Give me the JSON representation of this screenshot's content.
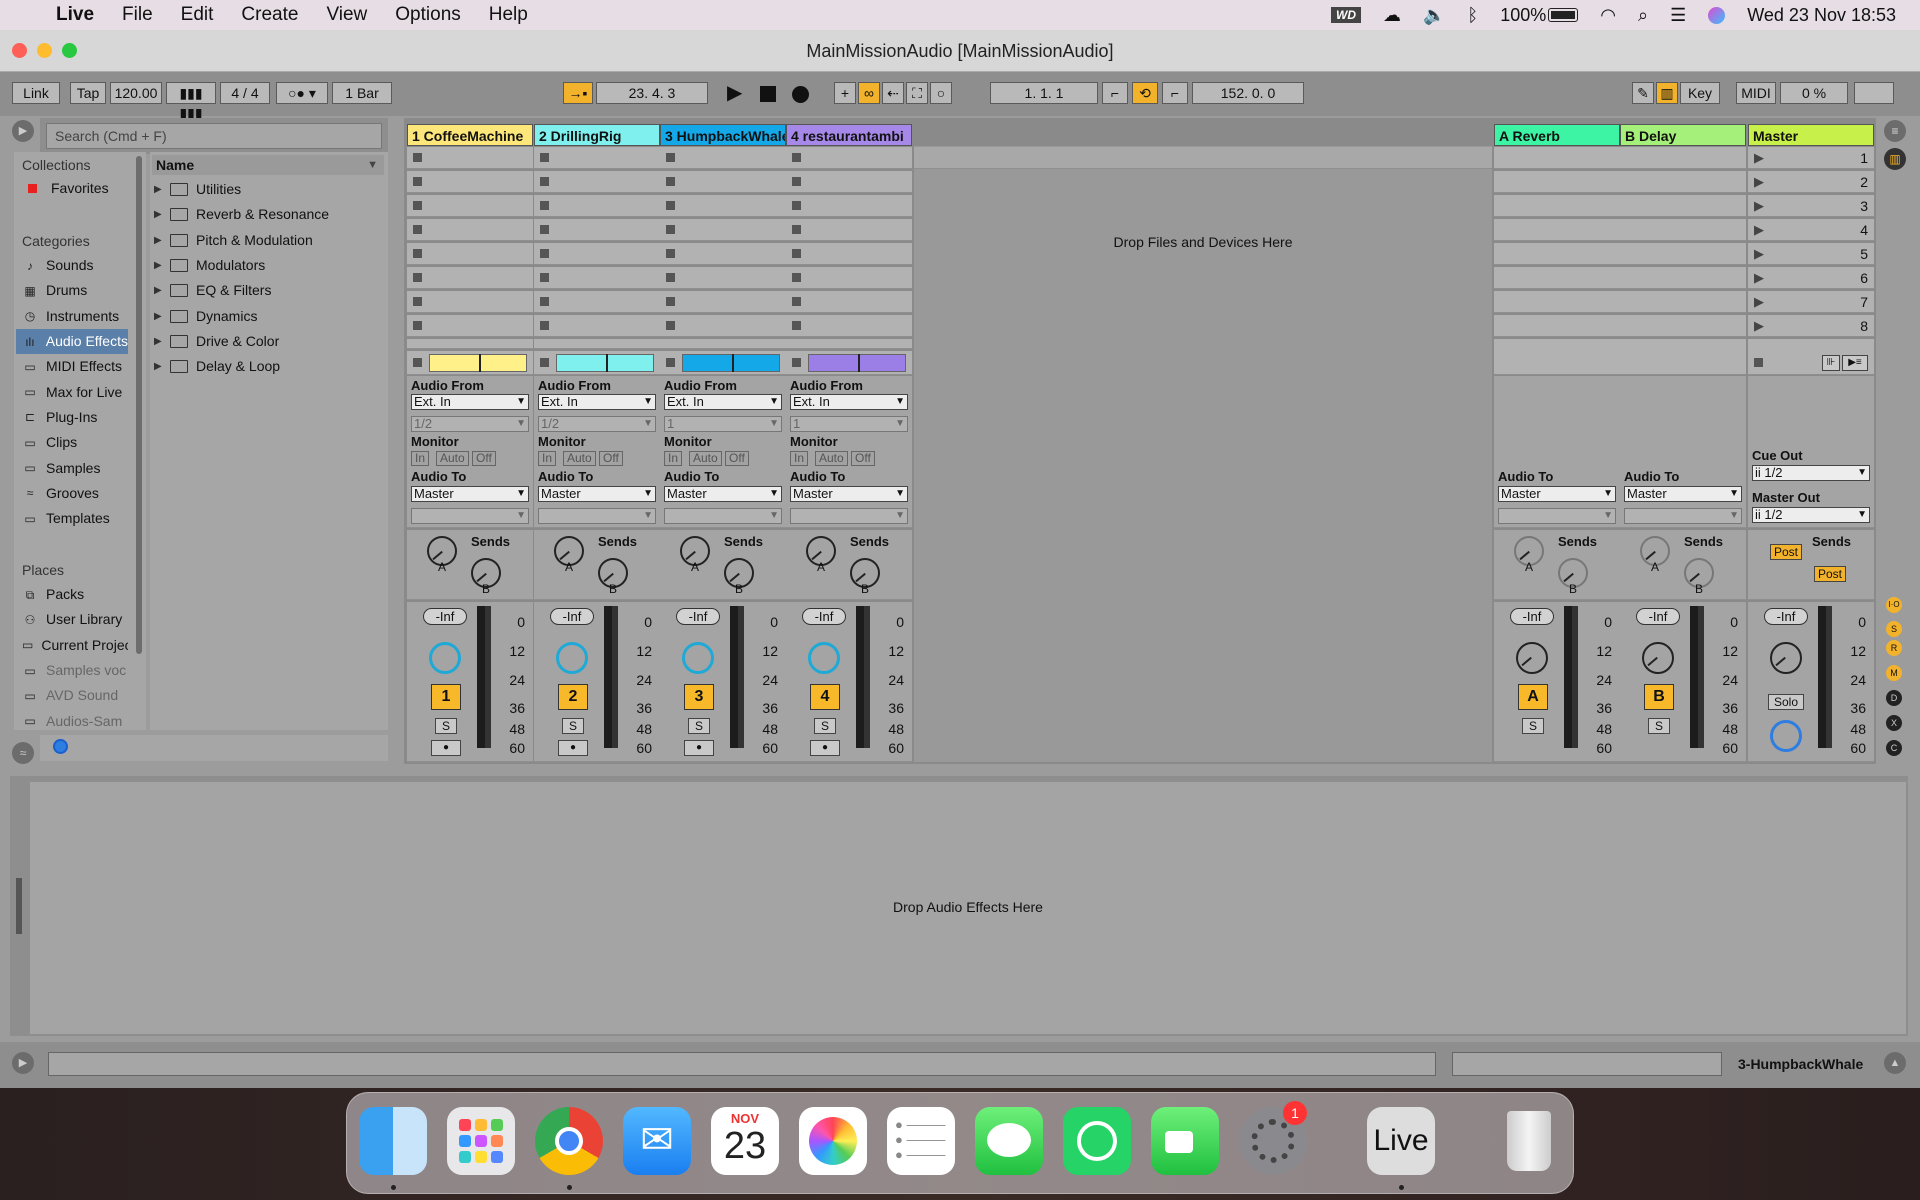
{
  "menubar": {
    "app": "Live",
    "items": [
      "File",
      "Edit",
      "Create",
      "View",
      "Options",
      "Help"
    ],
    "battery": "100%",
    "datetime": "Wed 23 Nov  18:53"
  },
  "window": {
    "title": "MainMissionAudio  [MainMissionAudio]"
  },
  "toolbar": {
    "link": "Link",
    "tap": "Tap",
    "tempo": "120.00",
    "signature": "4 / 4",
    "quant": "1 Bar",
    "position": "23.   4.   3",
    "loop_start": "1.   1.   1",
    "loop_length": "152.   0.   0",
    "key": "Key",
    "midi": "MIDI",
    "cpu": "0 %"
  },
  "browser": {
    "search_placeholder": "Search (Cmd + F)",
    "collections_label": "Collections",
    "favorites": "Favorites",
    "categories_label": "Categories",
    "categories": [
      {
        "label": "Sounds",
        "icon": "sounds-icon"
      },
      {
        "label": "Drums",
        "icon": "drums-icon"
      },
      {
        "label": "Instruments",
        "icon": "instruments-icon"
      },
      {
        "label": "Audio Effects",
        "icon": "audio-effects-icon"
      },
      {
        "label": "MIDI Effects",
        "icon": "midi-effects-icon"
      },
      {
        "label": "Max for Live",
        "icon": "max-icon"
      },
      {
        "label": "Plug-Ins",
        "icon": "plugins-icon"
      },
      {
        "label": "Clips",
        "icon": "clips-icon"
      },
      {
        "label": "Samples",
        "icon": "samples-icon"
      },
      {
        "label": "Grooves",
        "icon": "grooves-icon"
      },
      {
        "label": "Templates",
        "icon": "templates-icon"
      }
    ],
    "places_label": "Places",
    "places": [
      {
        "label": "Packs"
      },
      {
        "label": "User Library"
      },
      {
        "label": "Current Project"
      },
      {
        "label": "Samples voc"
      },
      {
        "label": "AVD Sound"
      },
      {
        "label": "Audios-Sam"
      }
    ],
    "name_header": "Name",
    "folders": [
      "Utilities",
      "Reverb & Resonance",
      "Pitch & Modulation",
      "Modulators",
      "EQ & Filters",
      "Dynamics",
      "Drive & Color",
      "Delay & Loop"
    ]
  },
  "tracks": [
    {
      "name": "1 CoffeeMachine",
      "color": "#fde77a",
      "clip": "#fff08a",
      "num": "1"
    },
    {
      "name": "2 DrillingRig",
      "color": "#7ff0ee",
      "clip": "#7ff0ee",
      "num": "2"
    },
    {
      "name": "3 HumpbackWhale",
      "color": "#14a8e8",
      "clip": "#14a8e8",
      "num": "3"
    },
    {
      "name": "4 restaurantambi",
      "color": "#a688e8",
      "clip": "#9b7ee6",
      "num": "4"
    }
  ],
  "returns": [
    {
      "name": "A Reverb",
      "color": "#3df4a4",
      "num": "A"
    },
    {
      "name": "B Delay",
      "color": "#a4f07a",
      "num": "B"
    }
  ],
  "master": {
    "name": "Master",
    "color": "#c8f04a",
    "scenes": [
      "1",
      "2",
      "3",
      "4",
      "5",
      "6",
      "7",
      "8"
    ],
    "cue_out": "Cue Out",
    "cue_val": "ii 1/2",
    "master_out": "Master Out",
    "master_val": "ii 1/2",
    "solo": "Solo"
  },
  "io": {
    "audio_from": "Audio From",
    "ext_in": "Ext. In",
    "ch12": "1/2",
    "ch1": "1",
    "monitor": "Monitor",
    "mon_in": "In",
    "mon_auto": "Auto",
    "mon_off": "Off",
    "audio_to": "Audio To",
    "master": "Master",
    "sends": "Sends",
    "post": "Post",
    "inf": "-Inf",
    "solo_s": "S",
    "a": "A",
    "b": "B"
  },
  "scale": [
    "0",
    "12",
    "24",
    "36",
    "48",
    "60"
  ],
  "drop_files": "Drop Files and Devices Here",
  "drop_effects": "Drop Audio Effects Here",
  "status_track": "3-HumpbackWhale",
  "dock": {
    "calendar_month": "NOV",
    "calendar_day": "23",
    "badge": "1",
    "live": "Live"
  }
}
